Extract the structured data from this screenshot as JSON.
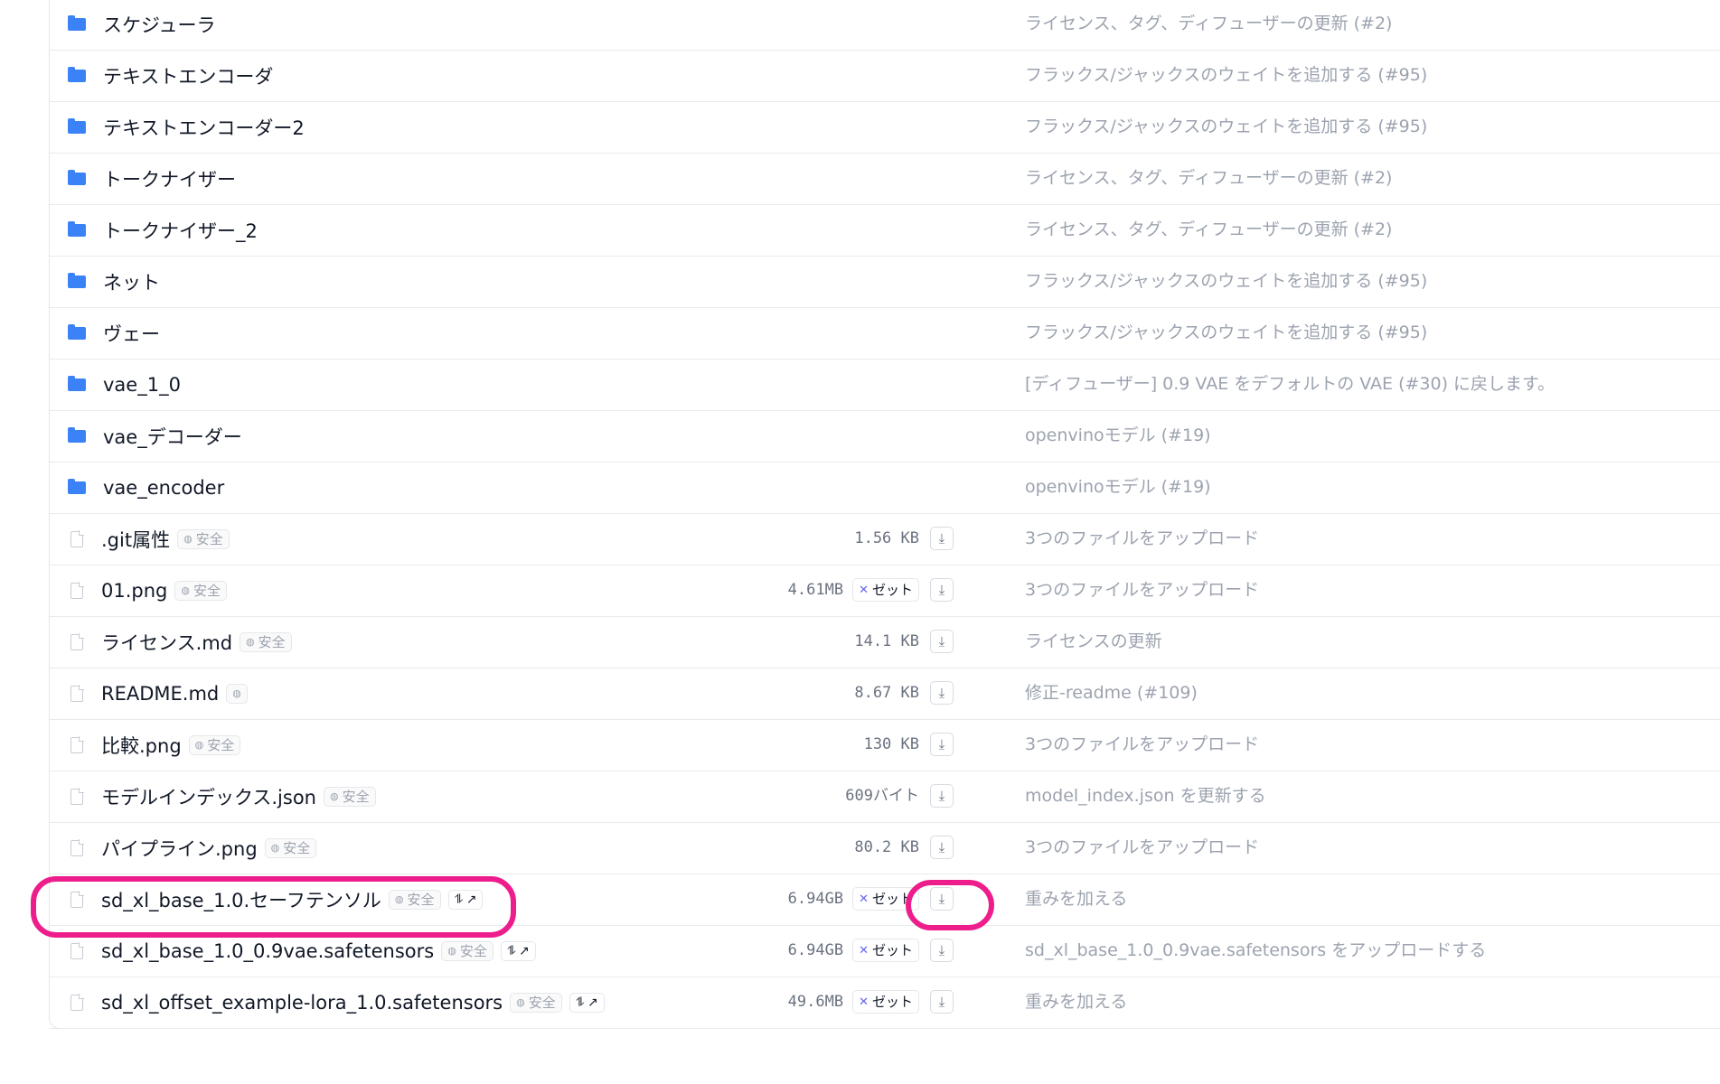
{
  "folders": [
    {
      "name": "スケジューラ",
      "commit": "ライセンス、タグ、ディフューザーの更新 (#2)"
    },
    {
      "name": "テキストエンコーダ",
      "commit": "フラックス/ジャックスのウェイトを追加する (#95)"
    },
    {
      "name": "テキストエンコーダー2",
      "commit": "フラックス/ジャックスのウェイトを追加する (#95)"
    },
    {
      "name": "トークナイザー",
      "commit": "ライセンス、タグ、ディフューザーの更新 (#2)"
    },
    {
      "name": "トークナイザー_2",
      "commit": "ライセンス、タグ、ディフューザーの更新 (#2)"
    },
    {
      "name": "ネット",
      "commit": "フラックス/ジャックスのウェイトを追加する (#95)"
    },
    {
      "name": "ヴェー",
      "commit": "フラックス/ジャックスのウェイトを追加する (#95)"
    },
    {
      "name": "vae_1_0",
      "commit": "[ディフューザー] 0.9 VAE をデフォルトの VAE (#30) に戻します。"
    },
    {
      "name": "vae_デコーダー",
      "commit": "openvinoモデル (#19)"
    },
    {
      "name": "vae_encoder",
      "commit": "openvinoモデル (#19)"
    }
  ],
  "files": [
    {
      "name": ".git属性",
      "badge": "安全",
      "size": "1.56 KB",
      "xet": "",
      "commit": "3つのファイルをアップロード"
    },
    {
      "name": "01.png",
      "badge": "安全",
      "size": "4.61MB",
      "xet": "ゼット",
      "commit": "3つのファイルをアップロード"
    },
    {
      "name": "ライセンス.md",
      "badge": "安全",
      "size": "14.1 KB",
      "xet": "",
      "commit": "ライセンスの更新"
    },
    {
      "name": "README.md",
      "badge": "",
      "size": "8.67 KB",
      "xet": "",
      "commit": "修正-readme (#109)"
    },
    {
      "name": "比較.png",
      "badge": "安全",
      "size": "130 KB",
      "xet": "",
      "commit": "3つのファイルをアップロード"
    },
    {
      "name": "モデルインデックス.json",
      "badge": "安全",
      "size": "609バイト",
      "xet": "",
      "commit": "model_index.json を更新する"
    },
    {
      "name": "パイプライン.png",
      "badge": "安全",
      "size": "80.2 KB",
      "xet": "",
      "commit": "3つのファイルをアップロード"
    },
    {
      "name": "sd_xl_base_1.0.セーフテンソル",
      "badge": "安全",
      "link": true,
      "size": "6.94GB",
      "xet": "ゼット",
      "commit": "重みを加える"
    },
    {
      "name": "sd_xl_base_1.0_0.9vae.safetensors",
      "badge": "安全",
      "link": true,
      "size": "6.94GB",
      "xet": "ゼット",
      "commit": "sd_xl_base_1.0_0.9vae.safetensors をアップロードする"
    },
    {
      "name": "sd_xl_offset_example-lora_1.0.safetensors",
      "badge": "安全",
      "link": true,
      "size": "49.6MB",
      "xet": "ゼット",
      "commit": "重みを加える"
    }
  ],
  "icons": {
    "folder": "folder-icon",
    "file": "file-icon",
    "download": "download-icon",
    "shield": "shield-icon",
    "xet": "xet-icon",
    "external_link": "external-link-icon"
  },
  "colors": {
    "folder": "#3b82f6",
    "highlight": "#ee1d8c",
    "xet_mark": "#6366f1"
  }
}
